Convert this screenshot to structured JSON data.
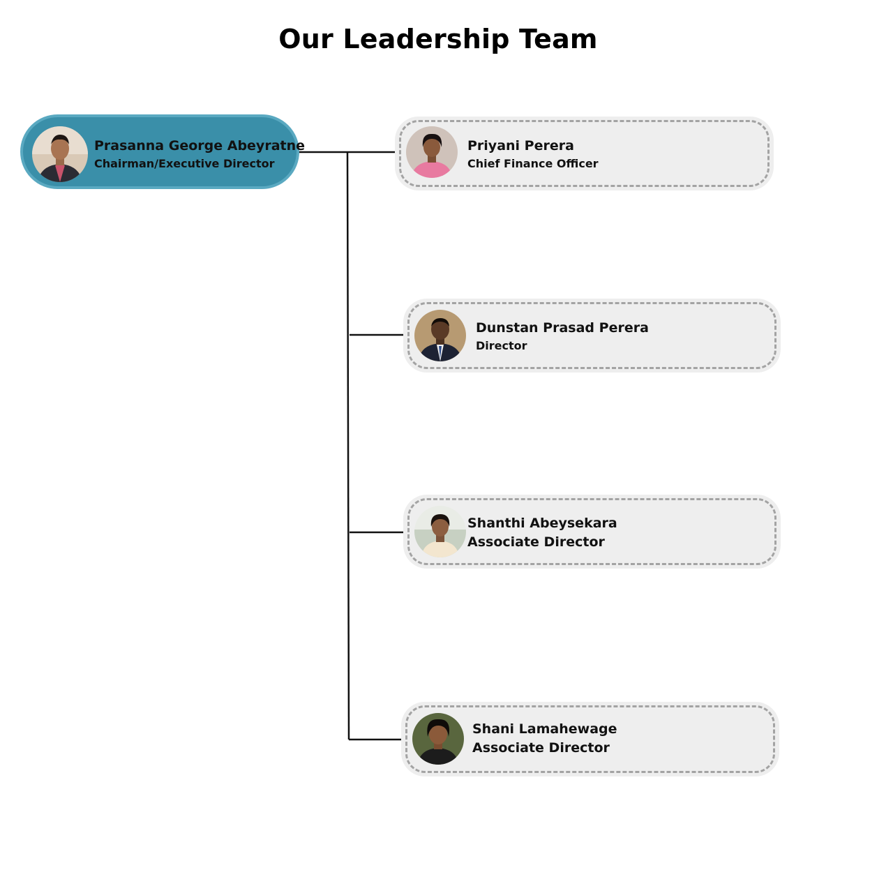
{
  "title": "Our Leadership Team",
  "lead": {
    "name": "Prasanna George Abeyratne",
    "role": "Chairman/Executive Director",
    "avatar_icon": "person-photo-icon",
    "color": "#3a8fa9"
  },
  "members": [
    {
      "name": "Priyani Perera",
      "role": "Chief Finance Officer",
      "avatar_icon": "person-photo-icon"
    },
    {
      "name": "Dunstan Prasad Perera",
      "role": "Director",
      "avatar_icon": "person-photo-icon"
    },
    {
      "name": "Shanthi Abeysekara",
      "role": "Associate Director",
      "avatar_icon": "person-photo-icon"
    },
    {
      "name": "Shani Lamahewage",
      "role": "Associate Director",
      "avatar_icon": "person-photo-icon"
    }
  ],
  "colors": {
    "card_background": "#eeeeee",
    "card_dash": "#a3a3a3",
    "connector": "#111111"
  }
}
